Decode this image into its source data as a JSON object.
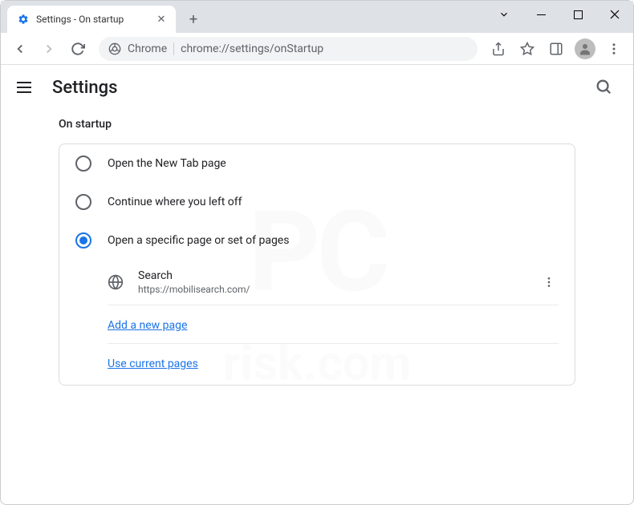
{
  "window": {
    "tab_title": "Settings - On startup"
  },
  "toolbar": {
    "omnibox_prefix": "Chrome",
    "omnibox_url": "chrome://settings/onStartup"
  },
  "settings": {
    "page_title": "Settings",
    "section_title": "On startup",
    "options": {
      "new_tab": "Open the New Tab page",
      "continue": "Continue where you left off",
      "specific": "Open a specific page or set of pages"
    },
    "pages": [
      {
        "name": "Search",
        "url": "https://mobilisearch.com/"
      }
    ],
    "add_page_link": "Add a new page",
    "use_current_link": "Use current pages"
  }
}
